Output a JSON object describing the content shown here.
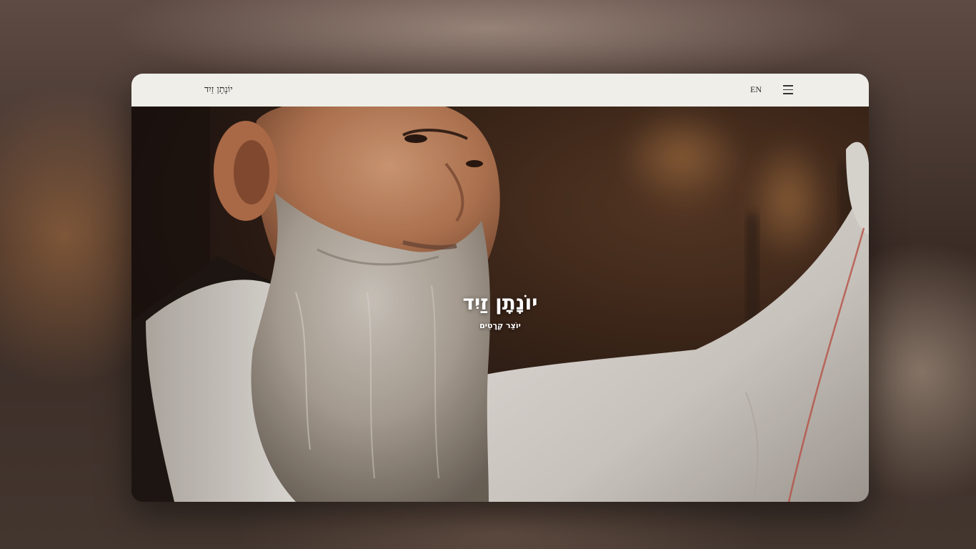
{
  "header": {
    "logo_text": "יוֹנָתָן זַיִד",
    "lang_label": "EN",
    "menu_icon": "hamburger-menu-icon"
  },
  "hero": {
    "title": "יוֹנָתָן זַיִד",
    "subtitle": "יוֹצֵר קְרָטִים",
    "image": "portrait-of-bearded-man-photo"
  },
  "colors": {
    "topbar_bg": "#efeee9",
    "hero_text": "#ffffff"
  }
}
